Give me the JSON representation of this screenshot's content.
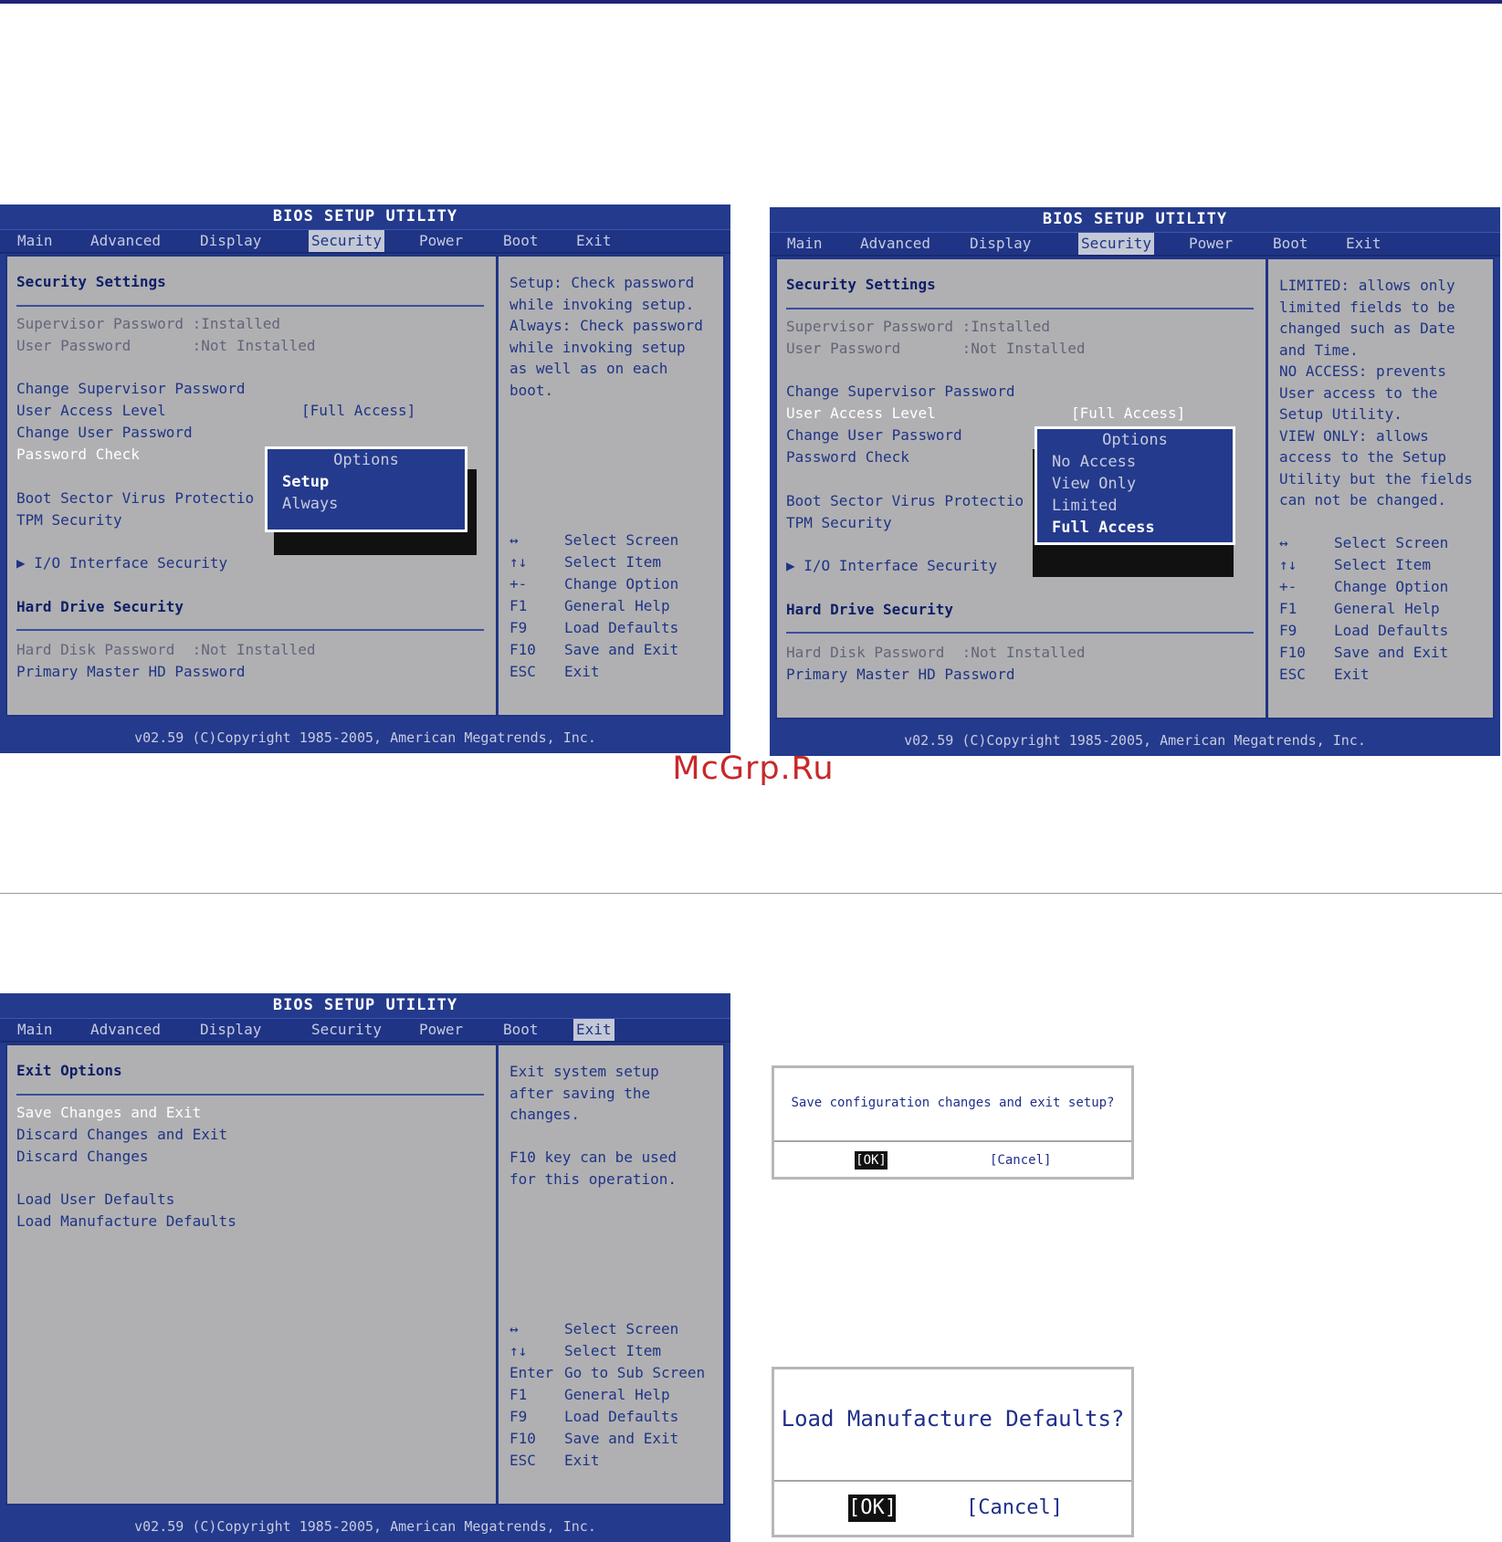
{
  "watermark": "McGrp.Ru",
  "bios_common": {
    "title": "BIOS SETUP UTILITY",
    "tabs": [
      "Main",
      "Advanced",
      "Display",
      "Security",
      "Power",
      "Boot",
      "Exit"
    ],
    "footer": "v02.59 (C)Copyright 1985-2005, American Megatrends, Inc."
  },
  "screen1": {
    "active_tab": "Security",
    "section_title": "Security Settings",
    "items": {
      "supervisor_password": "Supervisor Password :Installed",
      "user_password": "User Password       :Not Installed",
      "change_supervisor_password": "Change Supervisor Password",
      "user_access_level": "User Access Level",
      "user_access_level_value": "[Full Access]",
      "change_user_password": "Change User Password",
      "password_check": "Password Check",
      "boot_sector_virus": "Boot Sector Virus Protectio",
      "tpm_security": "TPM Security",
      "io_interface_security": "▶ I/O Interface Security",
      "hard_drive_security": "Hard Drive Security",
      "hard_disk_password": "Hard Disk Password  :Not Installed",
      "primary_master_hd_password": "Primary Master HD Password"
    },
    "popup": {
      "title": "Options",
      "options": [
        "Setup",
        "Always"
      ],
      "selected": "Setup"
    },
    "help_text": "Setup: Check password\nwhile invoking setup.\nAlways: Check password\nwhile invoking setup\nas well as on each\nboot.",
    "keys": [
      {
        "key": "↔",
        "action": "Select Screen"
      },
      {
        "key": "↑↓",
        "action": "Select Item"
      },
      {
        "key": "+-",
        "action": "Change Option"
      },
      {
        "key": "F1",
        "action": "General Help"
      },
      {
        "key": "F9",
        "action": "Load Defaults"
      },
      {
        "key": "F10",
        "action": "Save and Exit"
      },
      {
        "key": "ESC",
        "action": "Exit"
      }
    ]
  },
  "screen2": {
    "active_tab": "Security",
    "section_title": "Security Settings",
    "items": {
      "supervisor_password": "Supervisor Password :Installed",
      "user_password": "User Password       :Not Installed",
      "change_supervisor_password": "Change Supervisor Password",
      "user_access_level": "User Access Level",
      "user_access_level_value": "[Full Access]",
      "change_user_password": "Change User Password",
      "password_check": "Password Check",
      "boot_sector_virus": "Boot Sector Virus Protectio",
      "tpm_security": "TPM Security",
      "io_interface_security": "▶ I/O Interface Security",
      "hard_drive_security": "Hard Drive Security",
      "hard_disk_password": "Hard Disk Password  :Not Installed",
      "primary_master_hd_password": "Primary Master HD Password"
    },
    "popup": {
      "title": "Options",
      "options": [
        "No Access",
        "View Only",
        "Limited",
        "Full Access"
      ],
      "selected": "Full Access"
    },
    "help_text": "LIMITED: allows only\nlimited fields to be\nchanged such as Date\nand Time.\nNO ACCESS: prevents\nUser access to the\nSetup Utility.\nVIEW ONLY: allows\naccess to the Setup\nUtility but the fields\ncan not be changed.",
    "keys": [
      {
        "key": "↔",
        "action": "Select Screen"
      },
      {
        "key": "↑↓",
        "action": "Select Item"
      },
      {
        "key": "+-",
        "action": "Change Option"
      },
      {
        "key": "F1",
        "action": "General Help"
      },
      {
        "key": "F9",
        "action": "Load Defaults"
      },
      {
        "key": "F10",
        "action": "Save and Exit"
      },
      {
        "key": "ESC",
        "action": "Exit"
      }
    ]
  },
  "screen3": {
    "active_tab": "Exit",
    "section_title": "Exit Options",
    "items": {
      "save_changes_and_exit": "Save Changes and Exit",
      "discard_changes_and_exit": "Discard Changes and Exit",
      "discard_changes": "Discard Changes",
      "load_user_defaults": "Load User Defaults",
      "load_manufacture_defaults": "Load Manufacture Defaults"
    },
    "help_text": "Exit system setup\nafter saving the\nchanges.\n\nF10 key can be used\nfor this operation.",
    "keys": [
      {
        "key": "↔",
        "action": "Select Screen"
      },
      {
        "key": "↑↓",
        "action": "Select Item"
      },
      {
        "key": "Enter",
        "action": "Go to Sub Screen"
      },
      {
        "key": "F1",
        "action": "General Help"
      },
      {
        "key": "F9",
        "action": "Load Defaults"
      },
      {
        "key": "F10",
        "action": "Save and Exit"
      },
      {
        "key": "ESC",
        "action": "Exit"
      }
    ]
  },
  "dialog_save": {
    "question": "Save configuration changes and exit setup?",
    "ok_label": "[OK]",
    "cancel_label": "[Cancel]"
  },
  "dialog_load": {
    "question": "Load Manufacture Defaults?",
    "ok_label": "[OK]",
    "cancel_label": "[Cancel]"
  }
}
